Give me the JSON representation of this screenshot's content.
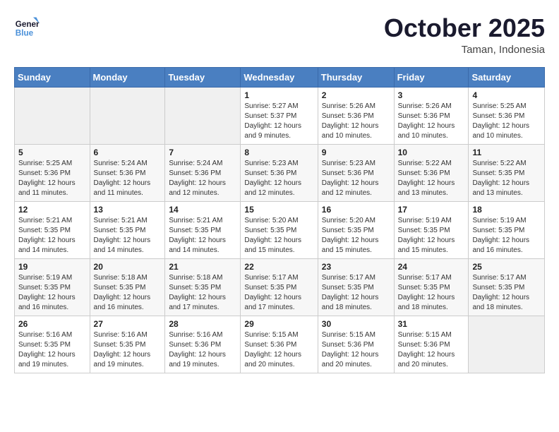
{
  "header": {
    "logo_general": "General",
    "logo_blue": "Blue",
    "month_year": "October 2025",
    "location": "Taman, Indonesia"
  },
  "days_of_week": [
    "Sunday",
    "Monday",
    "Tuesday",
    "Wednesday",
    "Thursday",
    "Friday",
    "Saturday"
  ],
  "weeks": [
    [
      {
        "day": "",
        "sunrise": "",
        "sunset": "",
        "daylight": ""
      },
      {
        "day": "",
        "sunrise": "",
        "sunset": "",
        "daylight": ""
      },
      {
        "day": "",
        "sunrise": "",
        "sunset": "",
        "daylight": ""
      },
      {
        "day": "1",
        "sunrise": "Sunrise: 5:27 AM",
        "sunset": "Sunset: 5:37 PM",
        "daylight": "Daylight: 12 hours and 9 minutes."
      },
      {
        "day": "2",
        "sunrise": "Sunrise: 5:26 AM",
        "sunset": "Sunset: 5:36 PM",
        "daylight": "Daylight: 12 hours and 10 minutes."
      },
      {
        "day": "3",
        "sunrise": "Sunrise: 5:26 AM",
        "sunset": "Sunset: 5:36 PM",
        "daylight": "Daylight: 12 hours and 10 minutes."
      },
      {
        "day": "4",
        "sunrise": "Sunrise: 5:25 AM",
        "sunset": "Sunset: 5:36 PM",
        "daylight": "Daylight: 12 hours and 10 minutes."
      }
    ],
    [
      {
        "day": "5",
        "sunrise": "Sunrise: 5:25 AM",
        "sunset": "Sunset: 5:36 PM",
        "daylight": "Daylight: 12 hours and 11 minutes."
      },
      {
        "day": "6",
        "sunrise": "Sunrise: 5:24 AM",
        "sunset": "Sunset: 5:36 PM",
        "daylight": "Daylight: 12 hours and 11 minutes."
      },
      {
        "day": "7",
        "sunrise": "Sunrise: 5:24 AM",
        "sunset": "Sunset: 5:36 PM",
        "daylight": "Daylight: 12 hours and 12 minutes."
      },
      {
        "day": "8",
        "sunrise": "Sunrise: 5:23 AM",
        "sunset": "Sunset: 5:36 PM",
        "daylight": "Daylight: 12 hours and 12 minutes."
      },
      {
        "day": "9",
        "sunrise": "Sunrise: 5:23 AM",
        "sunset": "Sunset: 5:36 PM",
        "daylight": "Daylight: 12 hours and 12 minutes."
      },
      {
        "day": "10",
        "sunrise": "Sunrise: 5:22 AM",
        "sunset": "Sunset: 5:36 PM",
        "daylight": "Daylight: 12 hours and 13 minutes."
      },
      {
        "day": "11",
        "sunrise": "Sunrise: 5:22 AM",
        "sunset": "Sunset: 5:35 PM",
        "daylight": "Daylight: 12 hours and 13 minutes."
      }
    ],
    [
      {
        "day": "12",
        "sunrise": "Sunrise: 5:21 AM",
        "sunset": "Sunset: 5:35 PM",
        "daylight": "Daylight: 12 hours and 14 minutes."
      },
      {
        "day": "13",
        "sunrise": "Sunrise: 5:21 AM",
        "sunset": "Sunset: 5:35 PM",
        "daylight": "Daylight: 12 hours and 14 minutes."
      },
      {
        "day": "14",
        "sunrise": "Sunrise: 5:21 AM",
        "sunset": "Sunset: 5:35 PM",
        "daylight": "Daylight: 12 hours and 14 minutes."
      },
      {
        "day": "15",
        "sunrise": "Sunrise: 5:20 AM",
        "sunset": "Sunset: 5:35 PM",
        "daylight": "Daylight: 12 hours and 15 minutes."
      },
      {
        "day": "16",
        "sunrise": "Sunrise: 5:20 AM",
        "sunset": "Sunset: 5:35 PM",
        "daylight": "Daylight: 12 hours and 15 minutes."
      },
      {
        "day": "17",
        "sunrise": "Sunrise: 5:19 AM",
        "sunset": "Sunset: 5:35 PM",
        "daylight": "Daylight: 12 hours and 15 minutes."
      },
      {
        "day": "18",
        "sunrise": "Sunrise: 5:19 AM",
        "sunset": "Sunset: 5:35 PM",
        "daylight": "Daylight: 12 hours and 16 minutes."
      }
    ],
    [
      {
        "day": "19",
        "sunrise": "Sunrise: 5:19 AM",
        "sunset": "Sunset: 5:35 PM",
        "daylight": "Daylight: 12 hours and 16 minutes."
      },
      {
        "day": "20",
        "sunrise": "Sunrise: 5:18 AM",
        "sunset": "Sunset: 5:35 PM",
        "daylight": "Daylight: 12 hours and 16 minutes."
      },
      {
        "day": "21",
        "sunrise": "Sunrise: 5:18 AM",
        "sunset": "Sunset: 5:35 PM",
        "daylight": "Daylight: 12 hours and 17 minutes."
      },
      {
        "day": "22",
        "sunrise": "Sunrise: 5:17 AM",
        "sunset": "Sunset: 5:35 PM",
        "daylight": "Daylight: 12 hours and 17 minutes."
      },
      {
        "day": "23",
        "sunrise": "Sunrise: 5:17 AM",
        "sunset": "Sunset: 5:35 PM",
        "daylight": "Daylight: 12 hours and 18 minutes."
      },
      {
        "day": "24",
        "sunrise": "Sunrise: 5:17 AM",
        "sunset": "Sunset: 5:35 PM",
        "daylight": "Daylight: 12 hours and 18 minutes."
      },
      {
        "day": "25",
        "sunrise": "Sunrise: 5:17 AM",
        "sunset": "Sunset: 5:35 PM",
        "daylight": "Daylight: 12 hours and 18 minutes."
      }
    ],
    [
      {
        "day": "26",
        "sunrise": "Sunrise: 5:16 AM",
        "sunset": "Sunset: 5:35 PM",
        "daylight": "Daylight: 12 hours and 19 minutes."
      },
      {
        "day": "27",
        "sunrise": "Sunrise: 5:16 AM",
        "sunset": "Sunset: 5:35 PM",
        "daylight": "Daylight: 12 hours and 19 minutes."
      },
      {
        "day": "28",
        "sunrise": "Sunrise: 5:16 AM",
        "sunset": "Sunset: 5:36 PM",
        "daylight": "Daylight: 12 hours and 19 minutes."
      },
      {
        "day": "29",
        "sunrise": "Sunrise: 5:15 AM",
        "sunset": "Sunset: 5:36 PM",
        "daylight": "Daylight: 12 hours and 20 minutes."
      },
      {
        "day": "30",
        "sunrise": "Sunrise: 5:15 AM",
        "sunset": "Sunset: 5:36 PM",
        "daylight": "Daylight: 12 hours and 20 minutes."
      },
      {
        "day": "31",
        "sunrise": "Sunrise: 5:15 AM",
        "sunset": "Sunset: 5:36 PM",
        "daylight": "Daylight: 12 hours and 20 minutes."
      },
      {
        "day": "",
        "sunrise": "",
        "sunset": "",
        "daylight": ""
      }
    ]
  ]
}
